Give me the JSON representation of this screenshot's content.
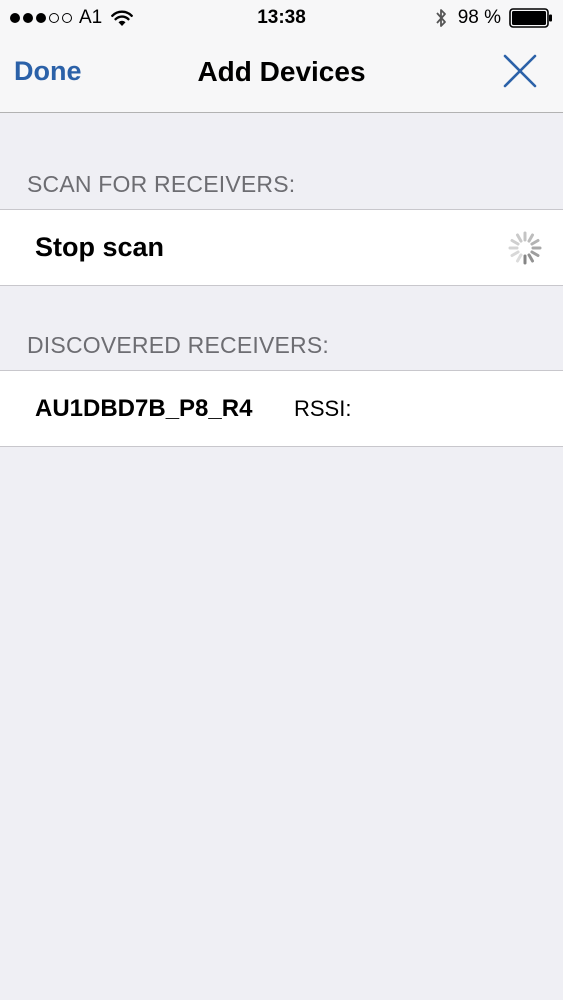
{
  "status_bar": {
    "carrier": "A1",
    "time": "13:38",
    "battery_percent": "98 %",
    "signal_strength": "3 of 5",
    "icons": [
      "signal-dots",
      "wifi-icon",
      "bluetooth-icon",
      "battery-icon"
    ]
  },
  "nav": {
    "done_label": "Done",
    "title": "Add Devices",
    "close_icon": "close-icon"
  },
  "scan_section": {
    "header": "SCAN FOR RECEIVERS:",
    "stop_scan_label": "Stop scan",
    "activity_icon": "spinner-icon"
  },
  "discovered_section": {
    "header": "DISCOVERED RECEIVERS:",
    "devices": [
      {
        "name": "AU1DBD7B_P8_R4",
        "rssi_label": "RSSI:"
      }
    ]
  },
  "colors": {
    "accent": "#2b61a8",
    "background": "#efeff4",
    "section_header": "#6d6d72",
    "cell_background": "#ffffff"
  }
}
